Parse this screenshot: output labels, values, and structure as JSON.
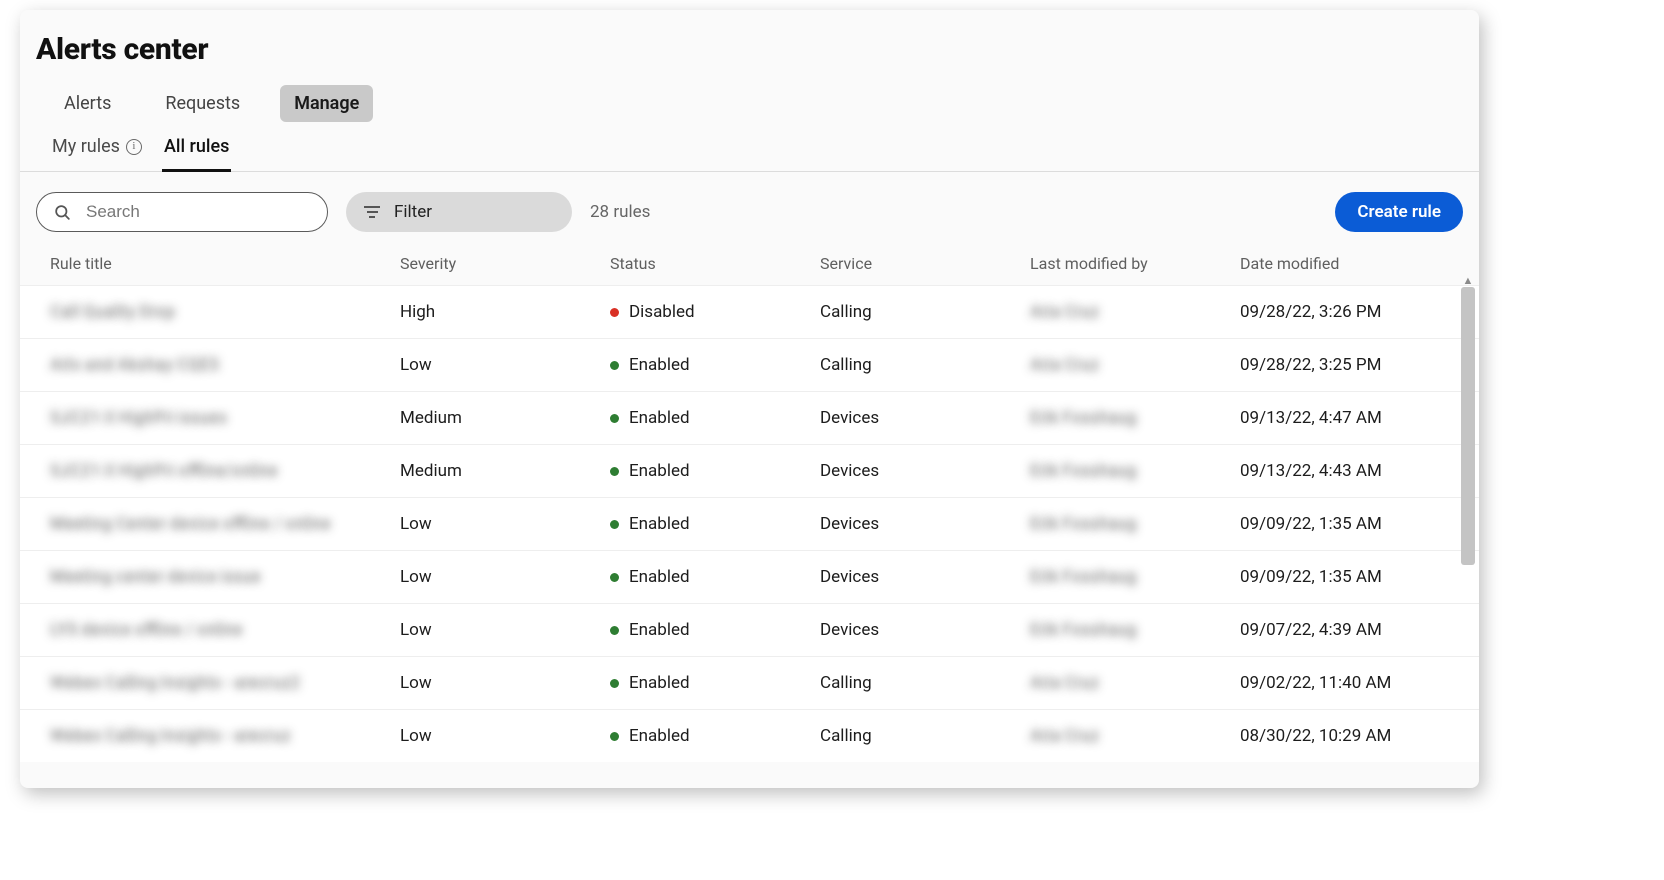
{
  "header": {
    "title": "Alerts center"
  },
  "tabs_primary": [
    {
      "label": "Alerts",
      "active": false
    },
    {
      "label": "Requests",
      "active": false
    },
    {
      "label": "Manage",
      "active": true
    }
  ],
  "tabs_secondary": [
    {
      "label": "My rules",
      "active": false,
      "info": true
    },
    {
      "label": "All rules",
      "active": true,
      "info": false
    }
  ],
  "toolbar": {
    "search_placeholder": "Search",
    "filter_label": "Filter",
    "count_text": "28 rules",
    "create_label": "Create rule"
  },
  "columns": {
    "title": "Rule title",
    "sev": "Severity",
    "status": "Status",
    "service": "Service",
    "by": "Last modified by",
    "date": "Date modified"
  },
  "status": {
    "enabled": "Enabled",
    "disabled": "Disabled",
    "colors": {
      "enabled": "#2e7d32",
      "disabled": "#d93025"
    }
  },
  "rows": [
    {
      "title": "Call Quality Drop",
      "sev": "High",
      "status": "disabled",
      "service": "Calling",
      "by": "Aria Cruz",
      "date": "09/28/22, 3:26 PM"
    },
    {
      "title": "Arlo and Akshay CQES",
      "sev": "Low",
      "status": "enabled",
      "service": "Calling",
      "by": "Aria Cruz",
      "date": "09/28/22, 3:25 PM"
    },
    {
      "title": "SJC21-3 HighPri issues",
      "sev": "Medium",
      "status": "enabled",
      "service": "Devices",
      "by": "Erik Fosshaug",
      "date": "09/13/22, 4:47 AM"
    },
    {
      "title": "SJC21-3 HighPri offline/online",
      "sev": "Medium",
      "status": "enabled",
      "service": "Devices",
      "by": "Erik Fosshaug",
      "date": "09/13/22, 4:43 AM"
    },
    {
      "title": "Meeting Center device offline / online",
      "sev": "Low",
      "status": "enabled",
      "service": "Devices",
      "by": "Erik Fosshaug",
      "date": "09/09/22, 1:35 AM"
    },
    {
      "title": "Meeting center device issue",
      "sev": "Low",
      "status": "enabled",
      "service": "Devices",
      "by": "Erik Fosshaug",
      "date": "09/09/22, 1:35 AM"
    },
    {
      "title": "LYS device offline / online",
      "sev": "Low",
      "status": "enabled",
      "service": "Devices",
      "by": "Erik Fosshaug",
      "date": "09/07/22, 4:39 AM"
    },
    {
      "title": "Webex Calling Insights - arecruz2",
      "sev": "Low",
      "status": "enabled",
      "service": "Calling",
      "by": "Aria Cruz",
      "date": "09/02/22, 11:40 AM"
    },
    {
      "title": "Webex Calling Insights - arecruz",
      "sev": "Low",
      "status": "enabled",
      "service": "Calling",
      "by": "Aria Cruz",
      "date": "08/30/22, 10:29 AM"
    }
  ]
}
